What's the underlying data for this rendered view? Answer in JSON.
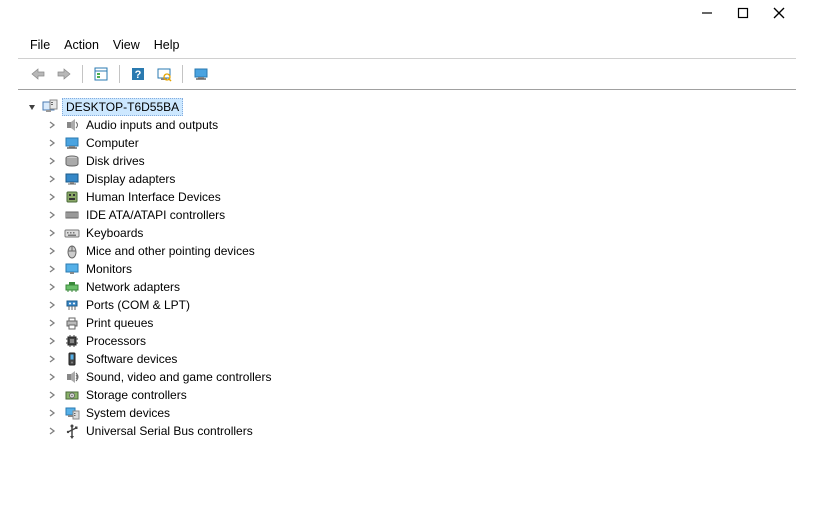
{
  "window": {
    "minimize_tooltip": "Minimize",
    "maximize_tooltip": "Maximize",
    "close_tooltip": "Close"
  },
  "menu": {
    "file": "File",
    "action": "Action",
    "view": "View",
    "help": "Help"
  },
  "toolbar": {
    "back_tooltip": "Back",
    "forward_tooltip": "Forward",
    "properties_tooltip": "Properties",
    "help_tooltip": "Help",
    "scan_tooltip": "Scan for hardware changes",
    "monitor_tooltip": "Show hidden devices"
  },
  "tree": {
    "root_label": "DESKTOP-T6D55BA",
    "items": [
      {
        "label": "Audio inputs and outputs",
        "icon": "audio"
      },
      {
        "label": "Computer",
        "icon": "computer"
      },
      {
        "label": "Disk drives",
        "icon": "disk"
      },
      {
        "label": "Display adapters",
        "icon": "display"
      },
      {
        "label": "Human Interface Devices",
        "icon": "hid"
      },
      {
        "label": "IDE ATA/ATAPI controllers",
        "icon": "ide"
      },
      {
        "label": "Keyboards",
        "icon": "keyboard"
      },
      {
        "label": "Mice and other pointing devices",
        "icon": "mouse"
      },
      {
        "label": "Monitors",
        "icon": "monitor"
      },
      {
        "label": "Network adapters",
        "icon": "network"
      },
      {
        "label": "Ports (COM & LPT)",
        "icon": "ports"
      },
      {
        "label": "Print queues",
        "icon": "printer"
      },
      {
        "label": "Processors",
        "icon": "cpu"
      },
      {
        "label": "Software devices",
        "icon": "software"
      },
      {
        "label": "Sound, video and game controllers",
        "icon": "sound"
      },
      {
        "label": "Storage controllers",
        "icon": "storage"
      },
      {
        "label": "System devices",
        "icon": "system"
      },
      {
        "label": "Universal Serial Bus controllers",
        "icon": "usb"
      }
    ]
  }
}
